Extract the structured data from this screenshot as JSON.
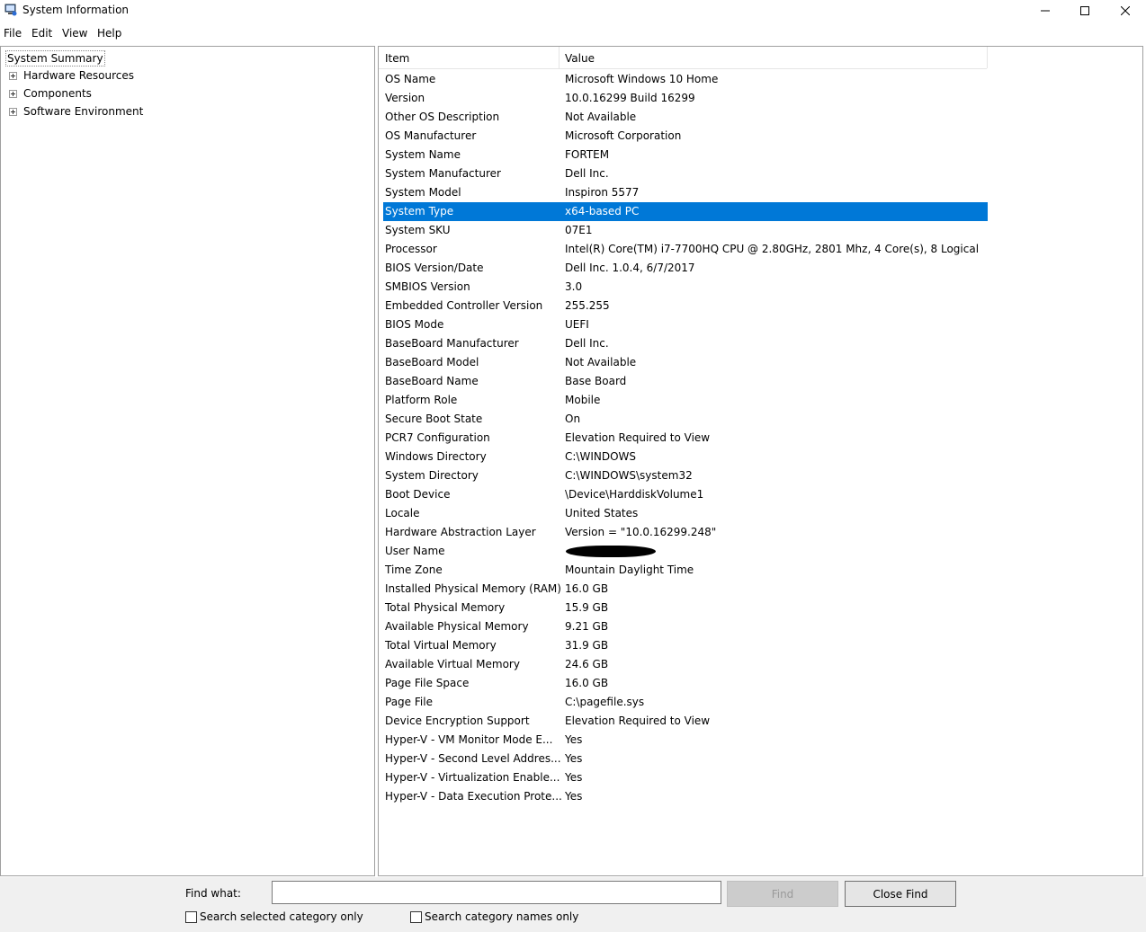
{
  "window": {
    "title": "System Information"
  },
  "menu": [
    "File",
    "Edit",
    "View",
    "Help"
  ],
  "tree": {
    "root": "System Summary",
    "children": [
      "Hardware Resources",
      "Components",
      "Software Environment"
    ]
  },
  "table": {
    "headers": {
      "item": "Item",
      "value": "Value"
    },
    "rows": [
      {
        "item": "OS Name",
        "value": "Microsoft Windows 10 Home"
      },
      {
        "item": "Version",
        "value": "10.0.16299 Build 16299"
      },
      {
        "item": "Other OS Description",
        "value": "Not Available"
      },
      {
        "item": "OS Manufacturer",
        "value": "Microsoft Corporation"
      },
      {
        "item": "System Name",
        "value": "FORTEM"
      },
      {
        "item": "System Manufacturer",
        "value": "Dell Inc."
      },
      {
        "item": "System Model",
        "value": "Inspiron 5577"
      },
      {
        "item": "System Type",
        "value": "x64-based PC"
      },
      {
        "item": "System SKU",
        "value": "07E1"
      },
      {
        "item": "Processor",
        "value": "Intel(R) Core(TM) i7-7700HQ CPU @ 2.80GHz, 2801 Mhz, 4 Core(s), 8 Logical ..."
      },
      {
        "item": "BIOS Version/Date",
        "value": "Dell Inc. 1.0.4, 6/7/2017"
      },
      {
        "item": "SMBIOS Version",
        "value": "3.0"
      },
      {
        "item": "Embedded Controller Version",
        "value": "255.255"
      },
      {
        "item": "BIOS Mode",
        "value": "UEFI"
      },
      {
        "item": "BaseBoard Manufacturer",
        "value": "Dell Inc."
      },
      {
        "item": "BaseBoard Model",
        "value": "Not Available"
      },
      {
        "item": "BaseBoard Name",
        "value": "Base Board"
      },
      {
        "item": "Platform Role",
        "value": "Mobile"
      },
      {
        "item": "Secure Boot State",
        "value": "On"
      },
      {
        "item": "PCR7 Configuration",
        "value": "Elevation Required to View"
      },
      {
        "item": "Windows Directory",
        "value": "C:\\WINDOWS"
      },
      {
        "item": "System Directory",
        "value": "C:\\WINDOWS\\system32"
      },
      {
        "item": "Boot Device",
        "value": "\\Device\\HarddiskVolume1"
      },
      {
        "item": "Locale",
        "value": "United States"
      },
      {
        "item": "Hardware Abstraction Layer",
        "value": "Version = \"10.0.16299.248\""
      },
      {
        "item": "User Name",
        "value": ""
      },
      {
        "item": "Time Zone",
        "value": "Mountain Daylight Time"
      },
      {
        "item": "Installed Physical Memory (RAM)",
        "value": "16.0 GB"
      },
      {
        "item": "Total Physical Memory",
        "value": "15.9 GB"
      },
      {
        "item": "Available Physical Memory",
        "value": "9.21 GB"
      },
      {
        "item": "Total Virtual Memory",
        "value": "31.9 GB"
      },
      {
        "item": "Available Virtual Memory",
        "value": "24.6 GB"
      },
      {
        "item": "Page File Space",
        "value": "16.0 GB"
      },
      {
        "item": "Page File",
        "value": "C:\\pagefile.sys"
      },
      {
        "item": "Device Encryption Support",
        "value": "Elevation Required to View"
      },
      {
        "item": "Hyper-V - VM Monitor Mode E...",
        "value": "Yes"
      },
      {
        "item": "Hyper-V - Second Level Addres...",
        "value": "Yes"
      },
      {
        "item": "Hyper-V - Virtualization Enable...",
        "value": "Yes"
      },
      {
        "item": "Hyper-V - Data Execution Prote...",
        "value": "Yes"
      }
    ],
    "selected_item": "System Type",
    "redacted_item": "User Name"
  },
  "find": {
    "label": "Find what:",
    "value": "",
    "find_button": "Find",
    "close_button": "Close Find",
    "checkbox_selected_category": "Search selected category only",
    "checkbox_category_names": "Search category names only"
  },
  "colors": {
    "selection": "#0078d7",
    "findbar_bg": "#f0f0f0"
  }
}
